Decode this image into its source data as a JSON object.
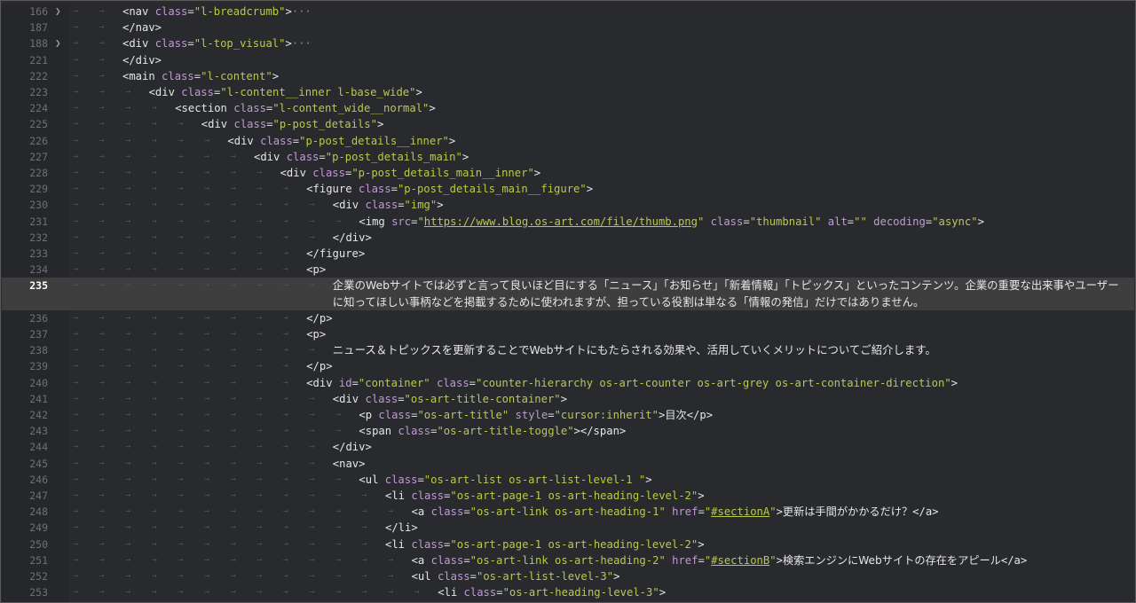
{
  "editor": {
    "lines": [
      {
        "n": "166",
        "depth": 2,
        "fold": true,
        "html": "<span class=\"tg\">&lt;nav</span> <span class=\"an\">class</span><span class=\"eq\">=</span><span class=\"av\">\"l-breadcrumb\"</span><span class=\"tg\">&gt;</span><span class=\"dots\">···</span>"
      },
      {
        "n": "187",
        "depth": 2,
        "html": "<span class=\"tg\">&lt;/nav&gt;</span>"
      },
      {
        "n": "188",
        "depth": 2,
        "fold": true,
        "html": "<span class=\"tg\">&lt;div</span> <span class=\"an\">class</span><span class=\"eq\">=</span><span class=\"av\">\"l-top_visual\"</span><span class=\"tg\">&gt;</span><span class=\"dots\">···</span>"
      },
      {
        "n": "221",
        "depth": 2,
        "html": "<span class=\"tg\">&lt;/div&gt;</span>"
      },
      {
        "n": "222",
        "depth": 2,
        "html": "<span class=\"tg\">&lt;main</span> <span class=\"an\">class</span><span class=\"eq\">=</span><span class=\"av\">\"l-content\"</span><span class=\"tg\">&gt;</span>"
      },
      {
        "n": "223",
        "depth": 3,
        "html": "<span class=\"tg\">&lt;div</span> <span class=\"an\">class</span><span class=\"eq\">=</span><span class=\"av\">\"l-content__inner l-base_wide\"</span><span class=\"tg\">&gt;</span>"
      },
      {
        "n": "224",
        "depth": 4,
        "html": "<span class=\"tg\">&lt;section</span> <span class=\"an\">class</span><span class=\"eq\">=</span><span class=\"av\">\"l-content_wide__normal\"</span><span class=\"tg\">&gt;</span>"
      },
      {
        "n": "225",
        "depth": 5,
        "html": "<span class=\"tg\">&lt;div</span> <span class=\"an\">class</span><span class=\"eq\">=</span><span class=\"av\">\"p-post_details\"</span><span class=\"tg\">&gt;</span>"
      },
      {
        "n": "226",
        "depth": 6,
        "html": "<span class=\"tg\">&lt;div</span> <span class=\"an\">class</span><span class=\"eq\">=</span><span class=\"av\">\"p-post_details__inner\"</span><span class=\"tg\">&gt;</span>"
      },
      {
        "n": "227",
        "depth": 7,
        "html": "<span class=\"tg\">&lt;div</span> <span class=\"an\">class</span><span class=\"eq\">=</span><span class=\"av\">\"p-post_details_main\"</span><span class=\"tg\">&gt;</span>"
      },
      {
        "n": "228",
        "depth": 8,
        "html": "<span class=\"tg\">&lt;div</span> <span class=\"an\">class</span><span class=\"eq\">=</span><span class=\"av\">\"p-post_details_main__inner\"</span><span class=\"tg\">&gt;</span>"
      },
      {
        "n": "229",
        "depth": 9,
        "html": "<span class=\"tg\">&lt;figure</span> <span class=\"an\">class</span><span class=\"eq\">=</span><span class=\"av\">\"p-post_details_main__figure\"</span><span class=\"tg\">&gt;</span>"
      },
      {
        "n": "230",
        "depth": 10,
        "html": "<span class=\"tg\">&lt;div</span> <span class=\"an\">class</span><span class=\"eq\">=</span><span class=\"av\">\"img\"</span><span class=\"tg\">&gt;</span>"
      },
      {
        "n": "231",
        "depth": 11,
        "html": "<span class=\"tg\">&lt;img</span> <span class=\"an\">src</span><span class=\"eq\">=</span><span class=\"av\">\"</span><span class=\"lnk\">https://www.blog.os-art.com/file/thumb.png</span><span class=\"av\">\"</span> <span class=\"an\">class</span><span class=\"eq\">=</span><span class=\"av\">\"thumbnail\"</span> <span class=\"an\">alt</span><span class=\"eq\">=</span><span class=\"av\">\"\"</span> <span class=\"an\">decoding</span><span class=\"eq\">=</span><span class=\"av\">\"async\"</span><span class=\"tg\">&gt;</span>"
      },
      {
        "n": "232",
        "depth": 10,
        "html": "<span class=\"tg\">&lt;/div&gt;</span>"
      },
      {
        "n": "233",
        "depth": 9,
        "html": "<span class=\"tg\">&lt;/figure&gt;</span>"
      },
      {
        "n": "234",
        "depth": 9,
        "html": "<span class=\"tg\">&lt;p&gt;</span>"
      },
      {
        "n": "235",
        "depth": 10,
        "active": true,
        "tall": true,
        "text": "企業のWebサイトでは必ずと言って良いほど目にする「ニュース」「お知らせ」「新着情報」「トピックス」といったコンテンツ。企業の重要な出来事やユーザーに知ってほしい事柄などを掲載するために使われますが、担っている役割は単なる「情報の発信」だけではありません。"
      },
      {
        "n": "236",
        "depth": 9,
        "html": "<span class=\"tg\">&lt;/p&gt;</span>"
      },
      {
        "n": "237",
        "depth": 9,
        "html": "<span class=\"tg\">&lt;p&gt;</span>"
      },
      {
        "n": "238",
        "depth": 10,
        "plain": true,
        "html": "ニュース＆トピックスを更新することでWebサイトにもたらされる効果や、活用していくメリットについてご紹介します。"
      },
      {
        "n": "239",
        "depth": 9,
        "html": "<span class=\"tg\">&lt;/p&gt;</span>"
      },
      {
        "n": "240",
        "depth": 9,
        "html": "<span class=\"tg\">&lt;div</span> <span class=\"an\">id</span><span class=\"eq\">=</span><span class=\"av\">\"container\"</span> <span class=\"an\">class</span><span class=\"eq\">=</span><span class=\"av\">\"counter-hierarchy os-art-counter os-art-grey os-art-container-direction\"</span><span class=\"tg\">&gt;</span>"
      },
      {
        "n": "241",
        "depth": 10,
        "html": "<span class=\"tg\">&lt;div</span> <span class=\"an\">class</span><span class=\"eq\">=</span><span class=\"av\">\"os-art-title-container\"</span><span class=\"tg\">&gt;</span>"
      },
      {
        "n": "242",
        "depth": 11,
        "html": "<span class=\"tg\">&lt;p</span> <span class=\"an\">class</span><span class=\"eq\">=</span><span class=\"av\">\"os-art-title\"</span> <span class=\"an\">style</span><span class=\"eq\">=</span><span class=\"av\">\"cursor:inherit\"</span><span class=\"tg\">&gt;</span><span class=\"txt\">目次</span><span class=\"tg\">&lt;/p&gt;</span>"
      },
      {
        "n": "243",
        "depth": 11,
        "html": "<span class=\"tg\">&lt;span</span> <span class=\"an\">class</span><span class=\"eq\">=</span><span class=\"av\">\"os-art-title-toggle\"</span><span class=\"tg\">&gt;&lt;/span&gt;</span>"
      },
      {
        "n": "244",
        "depth": 10,
        "html": "<span class=\"tg\">&lt;/div&gt;</span>"
      },
      {
        "n": "245",
        "depth": 10,
        "html": "<span class=\"tg\">&lt;nav&gt;</span>"
      },
      {
        "n": "246",
        "depth": 11,
        "html": "<span class=\"tg\">&lt;ul</span> <span class=\"an\">class</span><span class=\"eq\">=</span><span class=\"av\">\"os-art-list os-art-list-level-1 \"</span><span class=\"tg\">&gt;</span>"
      },
      {
        "n": "247",
        "depth": 12,
        "html": "<span class=\"tg\">&lt;li</span> <span class=\"an\">class</span><span class=\"eq\">=</span><span class=\"av\">\"os-art-page-1 os-art-heading-level-2\"</span><span class=\"tg\">&gt;</span>"
      },
      {
        "n": "248",
        "depth": 13,
        "html": "<span class=\"tg\">&lt;a</span> <span class=\"an\">class</span><span class=\"eq\">=</span><span class=\"av\">\"os-art-link os-art-heading-1\"</span> <span class=\"an\">href</span><span class=\"eq\">=</span><span class=\"av\">\"</span><span class=\"lnk\">#sectionA</span><span class=\"av\">\"</span><span class=\"tg\">&gt;</span><span class=\"txt\">更新は手間がかかるだけ？</span><span class=\"tg\">&lt;/a&gt;</span>"
      },
      {
        "n": "249",
        "depth": 12,
        "html": "<span class=\"tg\">&lt;/li&gt;</span>"
      },
      {
        "n": "250",
        "depth": 12,
        "html": "<span class=\"tg\">&lt;li</span> <span class=\"an\">class</span><span class=\"eq\">=</span><span class=\"av\">\"os-art-page-1 os-art-heading-level-2\"</span><span class=\"tg\">&gt;</span>"
      },
      {
        "n": "251",
        "depth": 13,
        "html": "<span class=\"tg\">&lt;a</span> <span class=\"an\">class</span><span class=\"eq\">=</span><span class=\"av\">\"os-art-link os-art-heading-2\"</span> <span class=\"an\">href</span><span class=\"eq\">=</span><span class=\"av\">\"</span><span class=\"lnk\">#sectionB</span><span class=\"av\">\"</span><span class=\"tg\">&gt;</span><span class=\"txt\">検索エンジンにWebサイトの存在をアピール</span><span class=\"tg\">&lt;/a&gt;</span>"
      },
      {
        "n": "252",
        "depth": 13,
        "html": "<span class=\"tg\">&lt;ul</span> <span class=\"an\">class</span><span class=\"eq\">=</span><span class=\"av\">\"os-art-list-level-3\"</span><span class=\"tg\">&gt;</span>"
      },
      {
        "n": "253",
        "depth": 14,
        "html": "<span class=\"tg\">&lt;li</span> <span class=\"an\">class</span><span class=\"eq\">=</span><span class=\"av\">\"os-art-heading-level-3\"</span><span class=\"tg\">&gt;</span>"
      }
    ]
  }
}
